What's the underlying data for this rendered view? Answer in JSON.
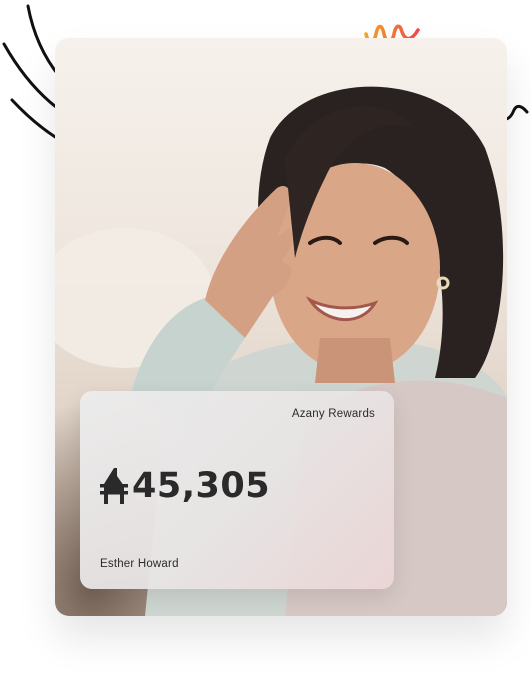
{
  "card": {
    "brand": "Azany Rewards",
    "amount": "45,305",
    "currency_icon": "naira-sign-icon",
    "holder": "Esther Howard"
  },
  "colors": {
    "amount_text": "#2a2a2a",
    "squiggle_orange": "#f5a623",
    "squiggle_red": "#ef4b4b",
    "deco_lines": "#111111"
  }
}
